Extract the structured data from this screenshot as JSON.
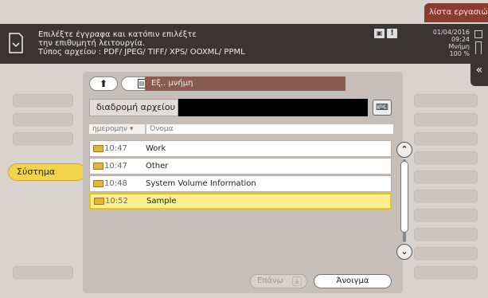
{
  "header": {
    "job_list_label": "λίστα εργασιών",
    "message_lines": [
      "Επιλέξτε έγγραφα και κατόπιν επιλέξτε",
      "την επιθυμητή λειτουργία.",
      "Τύπος αρχείου     : PDF/ JPEG/ TIFF/ XPS/ OOXML/ PPML"
    ],
    "status_icons": [
      "document-box-icon",
      "warning-icon"
    ],
    "date": "01/04/2016",
    "time": "09:24",
    "memory_label": "Μνήμη",
    "memory_value": "100 %",
    "collapse_icon": "double-chevron-left-icon"
  },
  "sidebar": {
    "system_label": "Σύστημα"
  },
  "browser": {
    "location_label": "Εξ.. μνήμη",
    "path_label": "διαδρομή αρχείου",
    "path_value": "",
    "columns": {
      "date": "ημερομην",
      "name": "Όνομα"
    },
    "sort_icon": "sort-down-icon",
    "rows": [
      {
        "time": "10:47",
        "name": "Work",
        "selected": false
      },
      {
        "time": "10:47",
        "name": "Other",
        "selected": false
      },
      {
        "time": "10:48",
        "name": "System Volume Information",
        "selected": false
      },
      {
        "time": "10:52",
        "name": "Sample",
        "selected": true
      }
    ],
    "upper_label": "Επάνω",
    "open_label": "Άνοιγμα"
  },
  "colors": {
    "accent": "#f2d44a",
    "header_bg": "#3a3432",
    "location_bg": "#8a5c50",
    "joblist_bg": "#8a3d2f",
    "selected_row": "#fdf08c"
  }
}
